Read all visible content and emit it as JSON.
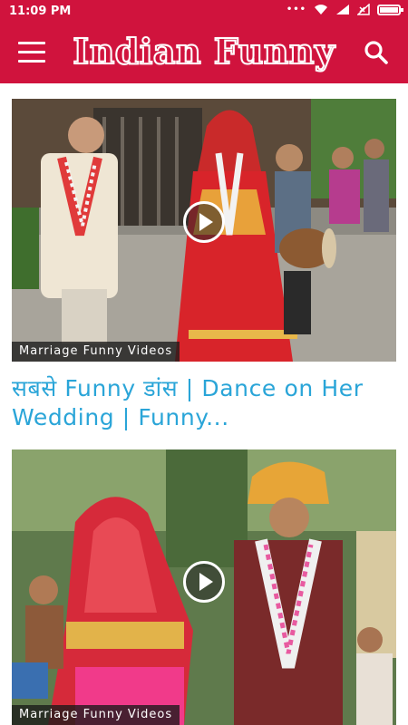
{
  "status_bar": {
    "time": "11:09 PM",
    "icons": [
      "dots-icon",
      "wifi-icon",
      "signal-icon",
      "no-sim-icon",
      "battery-icon"
    ]
  },
  "app_bar": {
    "title": "Indian Funny",
    "menu_icon": "menu-icon",
    "search_icon": "search-icon",
    "brand_color": "#d0133d"
  },
  "videos": [
    {
      "category": "Marriage Funny Videos",
      "title": "सबसे Funny डांस | Dance on Her Wedding | Funny..."
    },
    {
      "category": "Marriage Funny Videos",
      "title": ""
    }
  ],
  "colors": {
    "title_link": "#2aa5d8",
    "label_bg": "#191919"
  }
}
